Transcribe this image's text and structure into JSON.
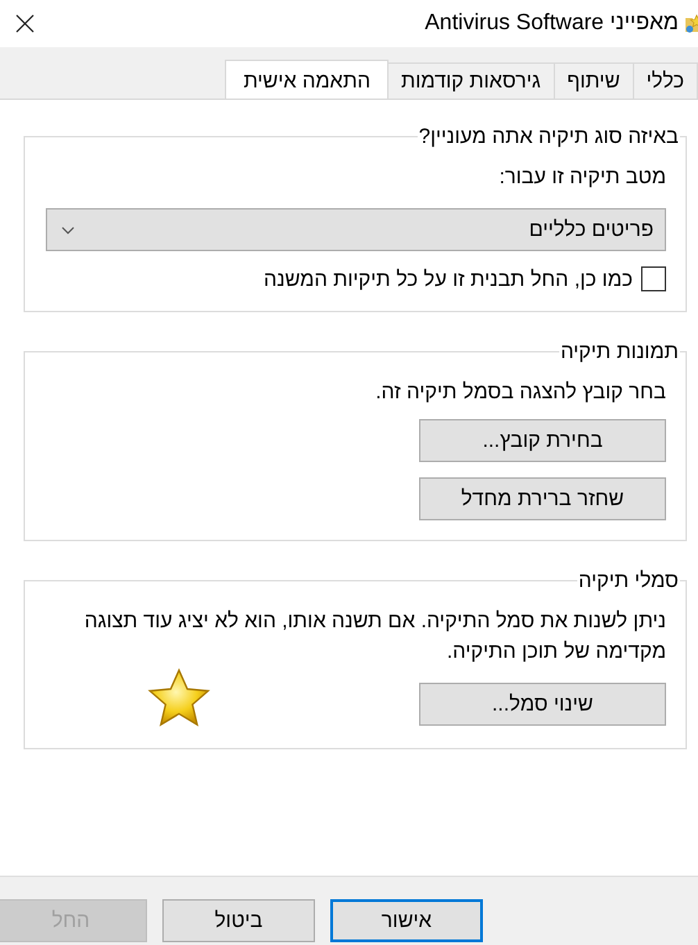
{
  "window": {
    "title": "מאפייני Antivirus Software"
  },
  "tabs": [
    {
      "label": "כללי",
      "selected": false
    },
    {
      "label": "שיתוף",
      "selected": false
    },
    {
      "label": "גירסאות קודמות",
      "selected": false
    },
    {
      "label": "התאמה אישית",
      "selected": true
    }
  ],
  "groups": [
    {
      "kind": "template",
      "legend": "באיזה סוג תיקיה אתה מעוניין?",
      "label": "מטב תיקיה זו עבור:",
      "dropdown": {
        "value": "פריטים כלליים"
      },
      "checkbox": {
        "label": "כמו כן, החל תבנית זו על כל תיקיות המשנה",
        "checked": false
      }
    },
    {
      "kind": "pictures",
      "legend": "תמונות תיקיה",
      "text": "בחר קובץ להצגה בסמל תיקיה זה.",
      "buttons": [
        {
          "label": "בחירת קובץ..."
        },
        {
          "label": "שחזר ברירת מחדל"
        }
      ]
    },
    {
      "kind": "icons",
      "legend": "סמלי תיקיה",
      "text": "ניתן לשנות את סמל התיקיה. אם תשנה אותו, הוא לא יציג עוד תצוגה מקדימה של תוכן התיקיה.",
      "buttons": [
        {
          "label": "שינוי סמל..."
        }
      ]
    }
  ],
  "buttons": [
    {
      "label": "אישור",
      "default": true,
      "disabled": false
    },
    {
      "label": "ביטול",
      "default": false,
      "disabled": false
    },
    {
      "label": "החל",
      "default": false,
      "disabled": true
    }
  ]
}
